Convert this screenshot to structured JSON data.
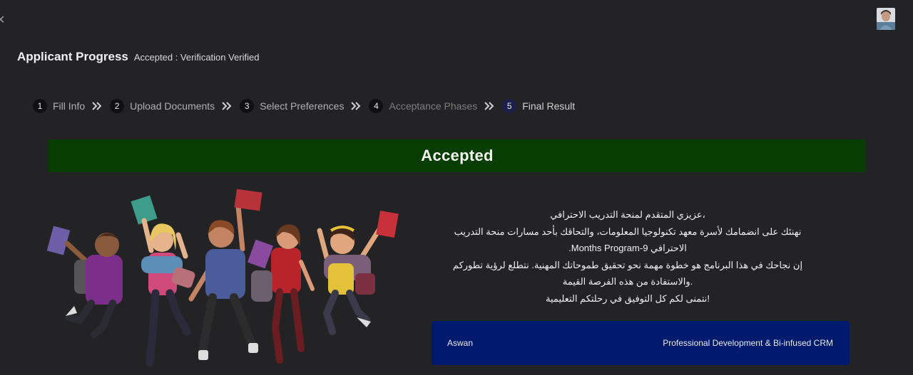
{
  "header": {
    "title": "Applicant Progress",
    "status": "Accepted : Verification Verified"
  },
  "steps": [
    {
      "number": "1",
      "label": "Fill Info"
    },
    {
      "number": "2",
      "label": "Upload Documents"
    },
    {
      "number": "3",
      "label": "Select Preferences"
    },
    {
      "number": "4",
      "label": "Acceptance Phases"
    },
    {
      "number": "5",
      "label": "Final Result"
    }
  ],
  "result": {
    "banner": "Accepted",
    "color": "#073d00"
  },
  "message": {
    "lines": [
      "،عزيزي المتقدم لمنحة التدريب الاحترافي",
      "نهنئك على انضمامك لأسرة معهد تكنولوجيا المعلومات، والتحاقك بأحد مسارات منحة التدريب",
      "الاحترافي 9-Months Program.",
      "إن نجاحك في هذا البرنامج هو خطوة مهمة نحو تحقيق طموحاتك المهنية. نتطلع لرؤية تطوركم",
      ".والاستفادة من هذه الفرصة القيمة",
      "!نتمنى لكم كل التوفيق في رحلتكم التعليمية"
    ]
  },
  "assignment": {
    "branch": "Aswan",
    "track": "Professional Development & Bi-infused CRM",
    "color": "#001a6e"
  },
  "icons": {
    "close": "close-icon",
    "avatar": "user-avatar",
    "separator": "double-chevron-right-icon",
    "illustration": "students-celebrating-illustration"
  }
}
